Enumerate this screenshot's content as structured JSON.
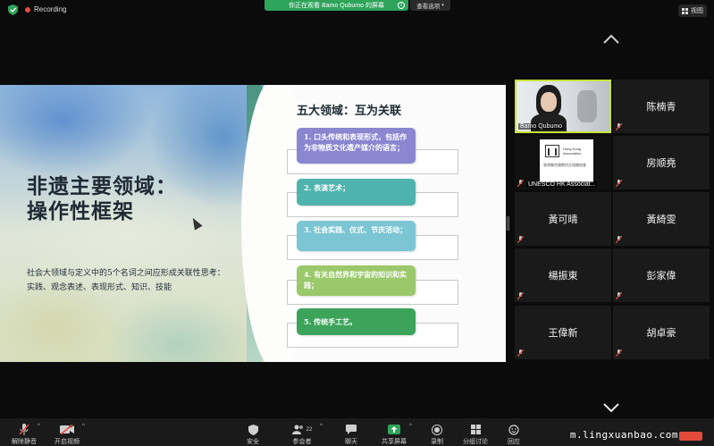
{
  "topbar": {
    "recording_label": "Recording",
    "viewing_banner": "你正在观看 Bamo Qubumo 的屏幕",
    "view_options_label": "查看选项",
    "view_button_label": "视图"
  },
  "slide": {
    "title_line1": "非遗主要领域：",
    "title_line2": "操作性框架",
    "subtitle_line1": "社会大领域与定义中的5个名词之间应形成关联性思考：",
    "subtitle_line2": "实践、观念表述、表现形式、知识、技能",
    "right_title": "五大领域：互为关联",
    "domains": [
      {
        "text": "1. 口头传统和表现形式，包括作为非物质文化遗产媒介的语言；",
        "color": "#8a86d0"
      },
      {
        "text": "2. 表演艺术；",
        "color": "#4fb3ad"
      },
      {
        "text": "3. 社会实践、仪式、节庆活动；",
        "color": "#7cc6d3"
      },
      {
        "text": "4. 有关自然界和宇宙的知识和实践；",
        "color": "#9ac86a"
      },
      {
        "text": "5. 传统手工艺。",
        "color": "#3ca45a"
      }
    ]
  },
  "participants": [
    {
      "name": "Bamo Qubumo",
      "video": true
    },
    {
      "name": "陈楠青",
      "video": false
    },
    {
      "name": "UNESCO HK Associat...",
      "video": true
    },
    {
      "name": "房顺堯",
      "video": false
    },
    {
      "name": "黃可晴",
      "video": false
    },
    {
      "name": "黃綺雯",
      "video": false
    },
    {
      "name": "楊振東",
      "video": false
    },
    {
      "name": "彭家偉",
      "video": false
    },
    {
      "name": "王偉新",
      "video": false
    },
    {
      "name": "胡卓豪",
      "video": false
    }
  ],
  "unesco_card": {
    "line1": "Hong Kong Association",
    "line2": "香港聯合國教科文組織協會"
  },
  "toolbar": {
    "unmute": "解除静音",
    "start_video": "开启视频",
    "security": "安全",
    "participants": "参会者",
    "participants_count": "22",
    "chat": "聊天",
    "share": "共享屏幕",
    "record": "录制",
    "breakout": "分组讨论",
    "reactions": "回应"
  },
  "watermark": "m.lingxuanbao.com",
  "colors": {
    "accent_green": "#2ea35a",
    "speaker_border": "#c8e23a",
    "muted_red": "#e24b3c"
  }
}
